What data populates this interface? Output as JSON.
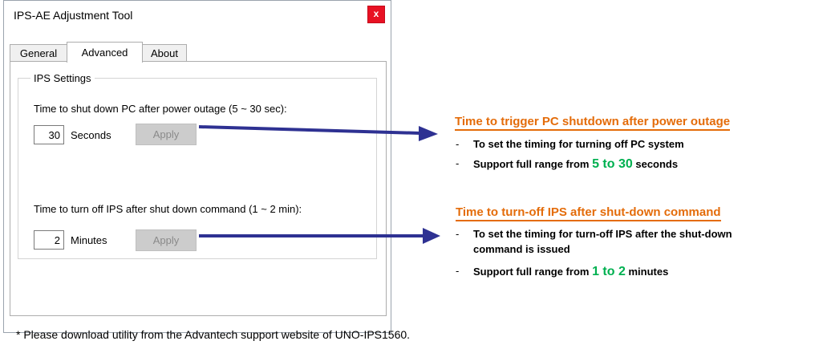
{
  "window": {
    "title": "IPS-AE Adjustment Tool",
    "close_label": "x",
    "tabs": [
      {
        "label": "General",
        "active": false
      },
      {
        "label": "Advanced",
        "active": true
      },
      {
        "label": "About",
        "active": false
      }
    ],
    "group_title": "IPS Settings",
    "pc_shutdown": {
      "label": "Time to shut down PC after power outage (5 ~ 30 sec):",
      "value": "30",
      "unit": "Seconds",
      "apply_label": "Apply"
    },
    "ips_off": {
      "label": "Time to turn off IPS after shut down command (1 ~ 2 min):",
      "value": "2",
      "unit": "Minutes",
      "apply_label": "Apply"
    }
  },
  "callouts": {
    "pc": {
      "title": "Time to trigger PC shutdown  after power outage",
      "bullet1": "To set the timing for turning off PC system",
      "bullet2_prefix": "Support full range from ",
      "bullet2_range": "5 to 30",
      "bullet2_suffix": "  seconds"
    },
    "ips": {
      "title": "Time to turn-off IPS after shut-down  command",
      "bullet1_line1": "To set the timing for turn-off IPS after the shut-down",
      "bullet1_line2": "command is issued",
      "bullet2_prefix": "Support full range from ",
      "bullet2_range": "1 to 2",
      "bullet2_suffix": " minutes"
    },
    "dash": "-"
  },
  "footnote": "* Please download utility  from the Advantech support website of UNO-IPS1560.",
  "colors": {
    "callout_title": "#e46c0a",
    "range_highlight": "#00b050",
    "arrow": "#2e3192",
    "close_button": "#e81123"
  }
}
